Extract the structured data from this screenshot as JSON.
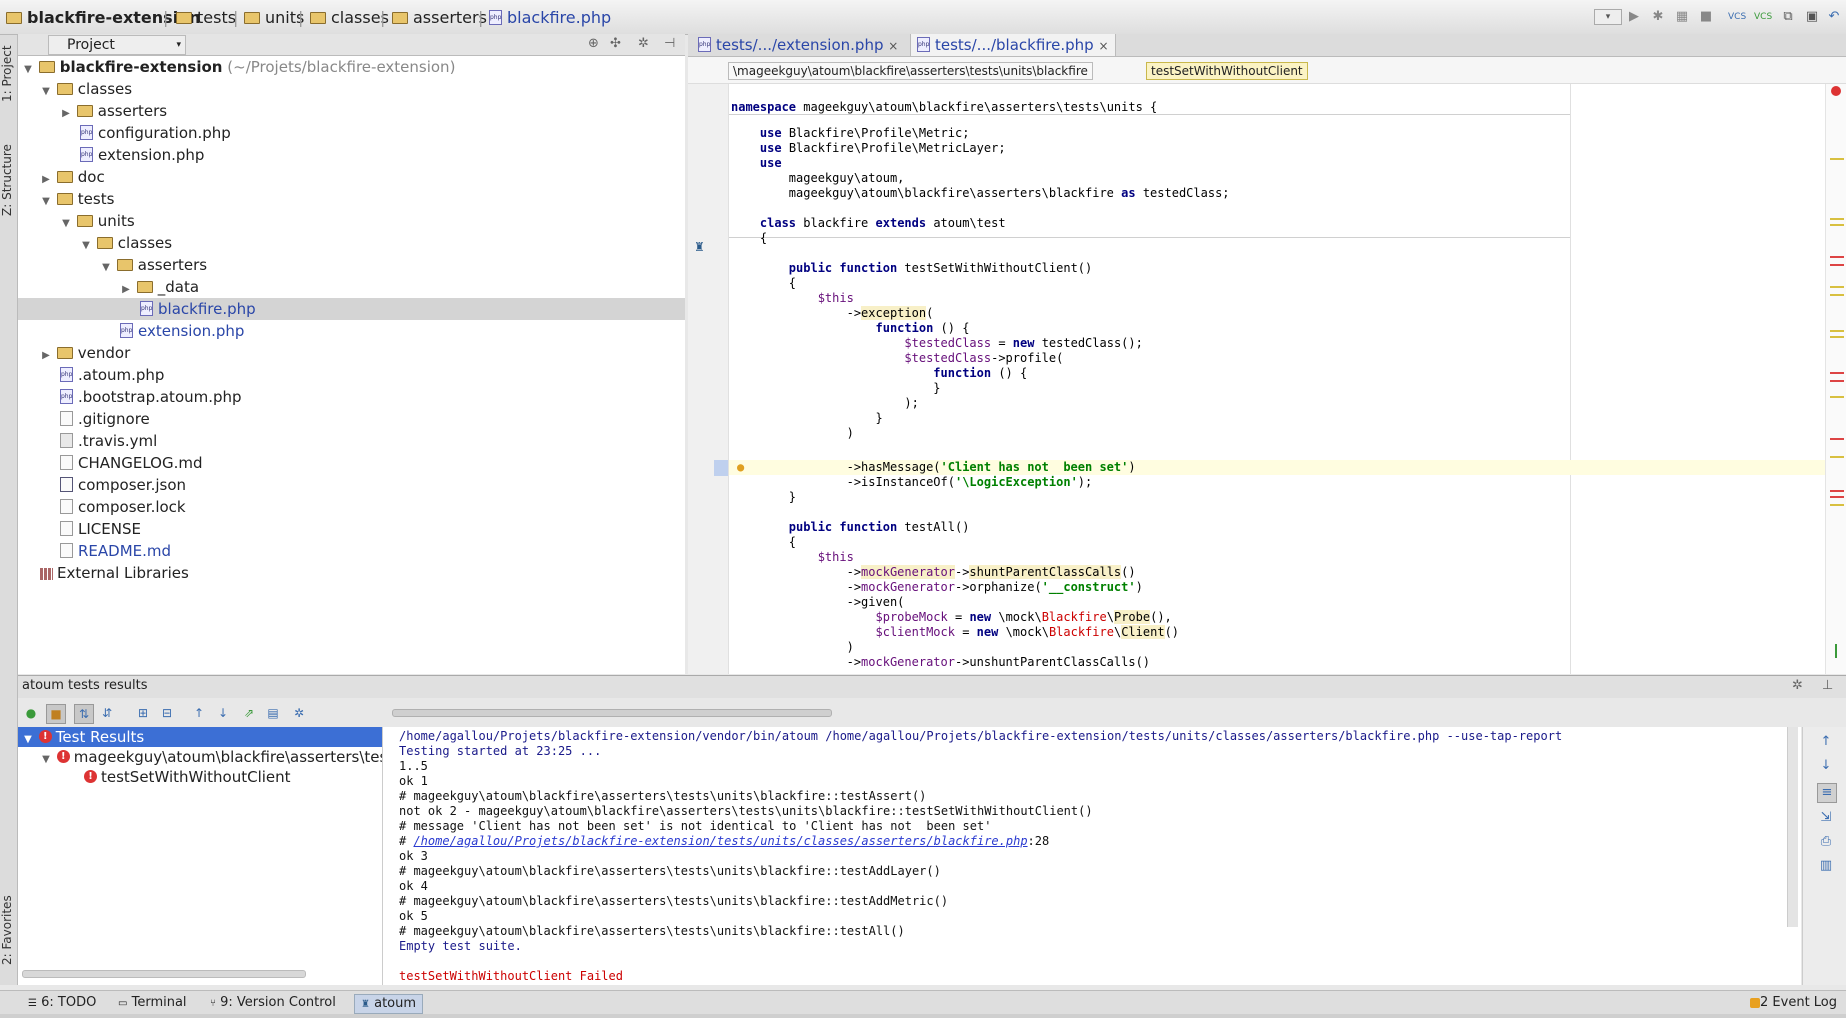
{
  "breadcrumb": [
    {
      "label": "blackfire-extension",
      "type": "folder"
    },
    {
      "label": "tests",
      "type": "folder"
    },
    {
      "label": "units",
      "type": "folder"
    },
    {
      "label": "classes",
      "type": "folder"
    },
    {
      "label": "asserters",
      "type": "folder"
    },
    {
      "label": "blackfire.php",
      "type": "php"
    }
  ],
  "left_strip": {
    "project_tab": "1: Project",
    "structure_tab": "Z: Structure",
    "favorites_tab": "2: Favorites"
  },
  "project_panel": {
    "title": "Project",
    "root_label": "blackfire-extension",
    "root_path": "(~/Projets/blackfire-extension)",
    "items": [
      {
        "label": "classes",
        "type": "folder"
      },
      {
        "label": "asserters",
        "type": "folder"
      },
      {
        "label": "configuration.php",
        "type": "php"
      },
      {
        "label": "extension.php",
        "type": "php"
      },
      {
        "label": "doc",
        "type": "folder"
      },
      {
        "label": "tests",
        "type": "folder"
      },
      {
        "label": "units",
        "type": "folder"
      },
      {
        "label": "classes",
        "type": "folder"
      },
      {
        "label": "asserters",
        "type": "folder"
      },
      {
        "label": "_data",
        "type": "folder"
      },
      {
        "label": "blackfire.php",
        "type": "php"
      },
      {
        "label": "extension.php",
        "type": "php"
      },
      {
        "label": "vendor",
        "type": "folder"
      },
      {
        "label": ".atoum.php",
        "type": "php"
      },
      {
        "label": ".bootstrap.atoum.php",
        "type": "php"
      },
      {
        "label": ".gitignore",
        "type": "file"
      },
      {
        "label": ".travis.yml",
        "type": "yml"
      },
      {
        "label": "CHANGELOG.md",
        "type": "file"
      },
      {
        "label": "composer.json",
        "type": "json"
      },
      {
        "label": "composer.lock",
        "type": "file"
      },
      {
        "label": "LICENSE",
        "type": "file"
      },
      {
        "label": "README.md",
        "type": "file"
      },
      {
        "label": "External Libraries",
        "type": "lib"
      }
    ]
  },
  "editor": {
    "tabs": [
      {
        "label": "tests/.../extension.php"
      },
      {
        "label": "tests/.../blackfire.php"
      }
    ],
    "crumbs": [
      "\\mageekguy\\atoum\\blackfire\\asserters\\tests\\units\\blackfire",
      "testSetWithWithoutClient"
    ],
    "code": [
      "",
      "",
      "namespace mageekguy\\atoum\\blackfire\\asserters\\tests\\units {",
      "",
      "    use Blackfire\\Profile\\Metric;",
      "    use Blackfire\\Profile\\MetricLayer;",
      "    use",
      "        mageekguy\\atoum,",
      "        mageekguy\\atoum\\blackfire\\asserters\\blackfire as testedClass;",
      "",
      "    class blackfire extends atoum\\test",
      "    {",
      "",
      "        public function testSetWithWithoutClient()",
      "        {",
      "            $this",
      "                ->exception(",
      "                    function () {",
      "                        $testedClass = new testedClass();",
      "                        $testedClass->profile(",
      "                            function () {",
      "                            }",
      "                        );",
      "                    }",
      "                )",
      "                ->hasMessage('Client has not  been set')",
      "                ->isInstanceOf('\\LogicException');",
      "        }",
      "",
      "        public function testAll()",
      "        {",
      "            $this",
      "                ->mockGenerator->shuntParentClassCalls()",
      "                ->mockGenerator->orphanize('__construct')",
      "                ->given(",
      "                    $probeMock = new \\mock\\Blackfire\\Probe(),",
      "                    $clientMock = new \\mock\\Blackfire\\Client()",
      "                )",
      "                ->mockGenerator->unshuntParentClassCalls()"
    ]
  },
  "bottom_panel": {
    "title": "atoum tests results",
    "tree": [
      {
        "label": "Test Results"
      },
      {
        "label": "mageekguy\\atoum\\blackfire\\asserters\\tests"
      },
      {
        "label": "testSetWithWithoutClient"
      }
    ],
    "console": [
      "/home/agallou/Projets/blackfire-extension/vendor/bin/atoum /home/agallou/Projets/blackfire-extension/tests/units/classes/asserters/blackfire.php --use-tap-report",
      "Testing started at 23:25 ...",
      "1..5",
      "ok 1",
      "# mageekguy\\atoum\\blackfire\\asserters\\tests\\units\\blackfire::testAssert()",
      "not ok 2 - mageekguy\\atoum\\blackfire\\asserters\\tests\\units\\blackfire::testSetWithWithoutClient()",
      "# message 'Client has not been set' is not identical to 'Client has not  been set'",
      "# ",
      "ok 3",
      "# mageekguy\\atoum\\blackfire\\asserters\\tests\\units\\blackfire::testAddLayer()",
      "ok 4",
      "# mageekguy\\atoum\\blackfire\\asserters\\tests\\units\\blackfire::testAddMetric()",
      "ok 5",
      "# mageekguy\\atoum\\blackfire\\asserters\\tests\\units\\blackfire::testAll()",
      "Empty test suite.",
      "",
      "testSetWithWithoutClient Failed"
    ],
    "console_link": "/home/agallou/Projets/blackfire-extension/tests/units/classes/asserters/blackfire.php",
    "console_link_line": ":28"
  },
  "status_bar": {
    "tabs": [
      "6: TODO",
      "Terminal",
      "9: Version Control",
      "atoum"
    ],
    "event_log": "Event Log",
    "event_log_count": "2"
  }
}
